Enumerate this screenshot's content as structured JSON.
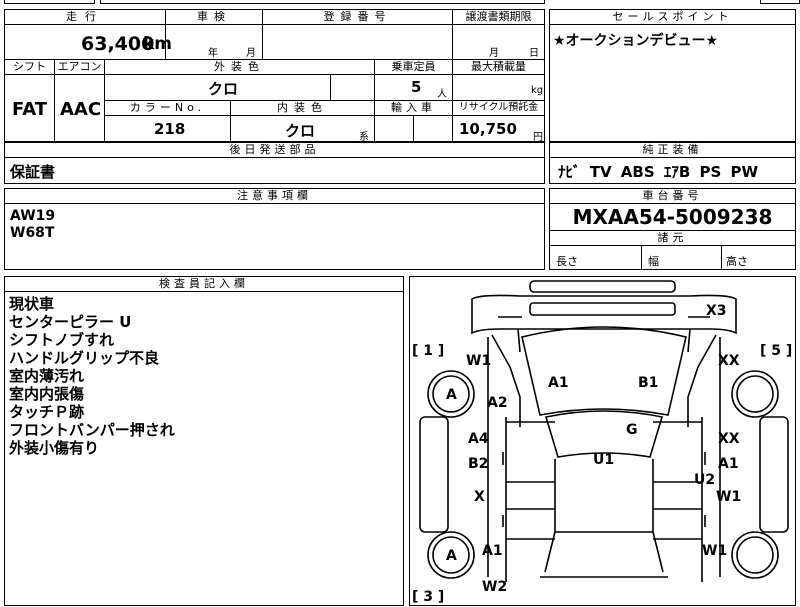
{
  "headers": {
    "mileage": "走行",
    "inspection": "車検",
    "reg_no": "登録番号",
    "transfer_deadline": "譲渡書類期限",
    "sales_point": "セールスポイント",
    "shift": "シフト",
    "aircon": "エアコン",
    "ext_color": "外装色",
    "capacity": "乗車定員",
    "max_load": "最大積載量",
    "color_no": "カラーNo.",
    "int_color": "内装色",
    "import": "輸入車",
    "recycle": "リサイクル預託金",
    "later_parts": "後日発送部品",
    "equipment": "純正装備",
    "caution": "注意事項欄",
    "chassis_no": "車台番号",
    "dims": "諸元",
    "inspector_notes": "検査員記入欄"
  },
  "vehicle": {
    "mileage": "63,400",
    "mileage_unit": "km",
    "year_label": "年",
    "month_label": "月",
    "month_label2": "月",
    "day_label": "日",
    "sales_point_text": "★オークションデビュー★",
    "shift": "FAT",
    "aircon": "AAC",
    "ext_color": "クロ",
    "capacity": "5",
    "capacity_unit": "人",
    "load_unit": "kg",
    "color_no": "218",
    "int_color": "クロ",
    "int_suffix": "系",
    "recycle": "10,750",
    "recycle_unit": "円",
    "later_parts": "保証書",
    "equipment": "ﾅﾋﾞ TV ABS ｴｱB PS PW",
    "caution_lines": [
      "AW19",
      "W68T"
    ],
    "chassis_no": "MXAA54-5009238",
    "dim_length": "長さ",
    "dim_width": "幅",
    "dim_height": "高さ"
  },
  "inspector_notes": [
    "現状車",
    "センターピラー U",
    "シフトノブすれ",
    "ハンドルグリップ不良",
    "室内薄汚れ",
    "室内内張傷",
    "タッチＰ跡",
    "フロントバンパー押され",
    "外装小傷有り"
  ],
  "diagram": {
    "brackets": [
      "[ 1 ]",
      "[ 5 ]",
      "[ 3 ]"
    ],
    "marks": {
      "x3": "X3",
      "w1_left": "W1",
      "a_wheel_fl": "A",
      "a2": "A2",
      "a1_hood": "A1",
      "b1_hood": "B1",
      "xx_right": "XX",
      "g": "G",
      "a4": "A4",
      "xx_right2": "XX",
      "b2": "B2",
      "u1": "U1",
      "a1_right": "A1",
      "u2": "U2",
      "x_left": "X",
      "w1_right": "W1",
      "a_wheel_rl": "A",
      "a1_rear": "A1",
      "w1_rear_right": "W1",
      "w2": "W2"
    }
  }
}
